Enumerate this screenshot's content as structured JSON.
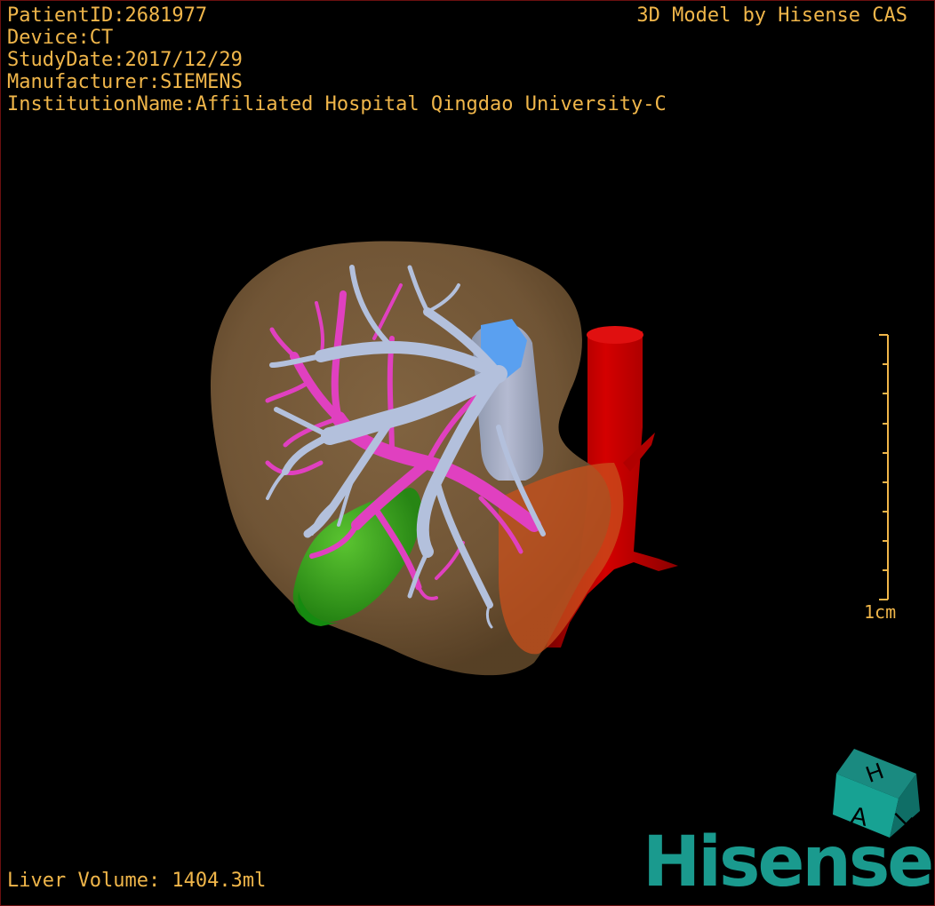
{
  "overlay": {
    "patient_id": "PatientID:2681977",
    "device": "Device:CT",
    "study_date": "StudyDate:2017/12/29",
    "manufacturer": "Manufacturer:SIEMENS",
    "institution": "InstitutionName:Affiliated Hospital Qingdao University-C",
    "credit": "3D Model by Hisense CAS",
    "liver_volume": "Liver Volume: 1404.3ml",
    "scale_label": "1cm"
  },
  "orientation_cube": {
    "letters": [
      "H",
      "A",
      "L"
    ]
  },
  "brand": {
    "name": "Hisense"
  },
  "colors": {
    "overlay_text": "#f0b64a",
    "liver": "#8a6a44",
    "hepatic_veins": "#a8b8d8",
    "portal_vein": "#e040c0",
    "gallbladder": "#40c020",
    "aorta": "#c00000",
    "brand": "#1a9a8e"
  }
}
